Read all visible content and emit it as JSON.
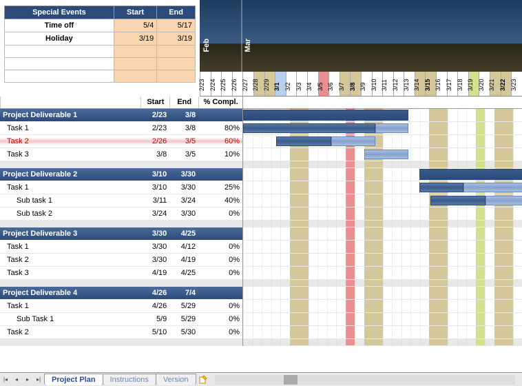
{
  "events": {
    "title": "Special Events",
    "cols": [
      "Start",
      "End"
    ],
    "rows": [
      {
        "name": "Time off",
        "start": "5/4",
        "end": "5/17"
      },
      {
        "name": "Holiday",
        "start": "3/19",
        "end": "3/19"
      },
      {
        "name": "",
        "start": "",
        "end": ""
      },
      {
        "name": "",
        "start": "",
        "end": ""
      },
      {
        "name": "",
        "start": "",
        "end": ""
      }
    ]
  },
  "months": [
    {
      "label": "Feb",
      "pos": 0
    },
    {
      "label": "Mar",
      "pos": 96
    }
  ],
  "dates": [
    "2/23",
    "2/24",
    "2/25",
    "2/26",
    "2/27",
    "2/28",
    "2/29",
    "3/1",
    "3/2",
    "3/3",
    "3/4",
    "3/5",
    "3/6",
    "3/7",
    "3/8",
    "3/9",
    "3/10",
    "3/11",
    "3/12",
    "3/13",
    "3/14",
    "3/15",
    "3/16",
    "3/17",
    "3/18",
    "3/19",
    "3/20",
    "3/21",
    "3/22",
    "3/23"
  ],
  "date_flags": [
    "",
    "",
    "",
    "",
    "",
    "we",
    "we",
    "bold sel",
    "",
    "",
    "",
    "hol",
    "",
    "we",
    "we bold",
    "",
    "",
    "",
    "",
    "",
    "we",
    "we bold",
    "",
    "",
    "",
    "sel2",
    "",
    "we",
    "we bold",
    "",
    ""
  ],
  "task_cols": [
    "Start",
    "End",
    "% Compl."
  ],
  "sections": [
    {
      "name": "Project Deliverable 1",
      "start": "2/23",
      "end": "3/8",
      "tasks": [
        {
          "name": "Task 1",
          "start": "2/23",
          "end": "3/8",
          "comp": "80%"
        },
        {
          "name": "Task 2",
          "start": "2/26",
          "end": "3/5",
          "comp": "60%",
          "overdue": true
        },
        {
          "name": "Task 3",
          "start": "3/8",
          "end": "3/5",
          "comp": "10%"
        }
      ]
    },
    {
      "name": "Project Deliverable 2",
      "start": "3/10",
      "end": "3/30",
      "tasks": [
        {
          "name": "Task 1",
          "start": "3/10",
          "end": "3/30",
          "comp": "25%"
        },
        {
          "name": "Sub task 1",
          "start": "3/11",
          "end": "3/24",
          "comp": "40%",
          "sub": true
        },
        {
          "name": "Sub task 2",
          "start": "3/24",
          "end": "3/30",
          "comp": "0%",
          "sub": true
        }
      ]
    },
    {
      "name": "Project Deliverable 3",
      "start": "3/30",
      "end": "4/25",
      "tasks": [
        {
          "name": "Task 1",
          "start": "3/30",
          "end": "4/12",
          "comp": "0%"
        },
        {
          "name": "Task 2",
          "start": "3/30",
          "end": "4/19",
          "comp": "0%"
        },
        {
          "name": "Task 3",
          "start": "4/19",
          "end": "4/25",
          "comp": "0%"
        }
      ]
    },
    {
      "name": "Project Deliverable 4",
      "start": "4/26",
      "end": "7/4",
      "tasks": [
        {
          "name": "Task 1",
          "start": "4/26",
          "end": "5/29",
          "comp": "0%"
        },
        {
          "name": "Sub Task 1",
          "start": "5/9",
          "end": "5/29",
          "comp": "0%",
          "sub": true
        },
        {
          "name": "Task 2",
          "start": "5/10",
          "end": "5/30",
          "comp": "0%"
        }
      ]
    }
  ],
  "chart_data": {
    "type": "gantt",
    "x_start": "2/23",
    "x_end": "3/23",
    "bars": [
      {
        "section": 0,
        "row": "deliv",
        "from": "2/23",
        "to": "3/8"
      },
      {
        "section": 0,
        "row": 0,
        "from": "2/23",
        "to": "3/8",
        "done": 0.8
      },
      {
        "section": 0,
        "row": 1,
        "from": "2/26",
        "to": "3/5",
        "done": 0.6
      },
      {
        "section": 0,
        "row": 2,
        "from": "3/5",
        "to": "3/8",
        "done": 0.1
      },
      {
        "section": 1,
        "row": "deliv",
        "from": "3/10",
        "to": "3/23"
      },
      {
        "section": 1,
        "row": 0,
        "from": "3/10",
        "to": "3/23",
        "done": 0.25
      },
      {
        "section": 1,
        "row": 1,
        "from": "3/11",
        "to": "3/23",
        "done": 0.4
      },
      {
        "section": 1,
        "row": 2,
        "from": "3/23",
        "to": "3/23",
        "done": 0
      }
    ]
  },
  "tabs": [
    {
      "label": "Project Plan",
      "active": true
    },
    {
      "label": "Instructions",
      "active": false
    },
    {
      "label": "Version",
      "active": false
    }
  ]
}
